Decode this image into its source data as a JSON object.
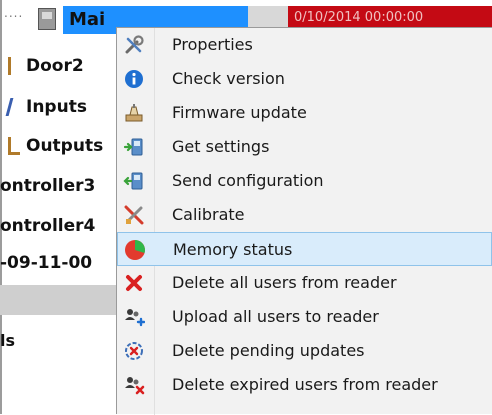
{
  "tree": {
    "dots": "....",
    "selected_label": "Mai",
    "status_text": "0/10/2014 00:00:00",
    "rows": [
      {
        "label": "Door2"
      },
      {
        "label": "Inputs"
      },
      {
        "label": "Outputs"
      },
      {
        "label": "ontroller3"
      },
      {
        "label": "ontroller4"
      },
      {
        "label": "-09-11-00"
      },
      {
        "label": "ls"
      }
    ]
  },
  "context_menu": {
    "items": [
      {
        "label": "Properties",
        "icon": "tools-icon"
      },
      {
        "label": "Check version",
        "icon": "info-icon"
      },
      {
        "label": "Firmware update",
        "icon": "firmware-icon"
      },
      {
        "label": "Get settings",
        "icon": "get-settings-icon"
      },
      {
        "label": "Send configuration",
        "icon": "send-configuration-icon"
      },
      {
        "label": "Calibrate",
        "icon": "calibrate-icon"
      },
      {
        "label": "Memory status",
        "icon": "memory-pie-icon",
        "hovered": true
      },
      {
        "label": "Delete all users from reader",
        "icon": "delete-x-icon"
      },
      {
        "label": "Upload all users to reader",
        "icon": "users-upload-icon"
      },
      {
        "label": "Delete pending updates",
        "icon": "delete-pending-icon"
      },
      {
        "label": "Delete expired users from reader",
        "icon": "users-delete-icon"
      }
    ]
  },
  "colors": {
    "selection": "#1e90ff",
    "status_red": "#c40a14",
    "menu_bg": "#f2f2f2",
    "hover_bg": "#d9ecfb",
    "hover_border": "#8fc3ea"
  }
}
